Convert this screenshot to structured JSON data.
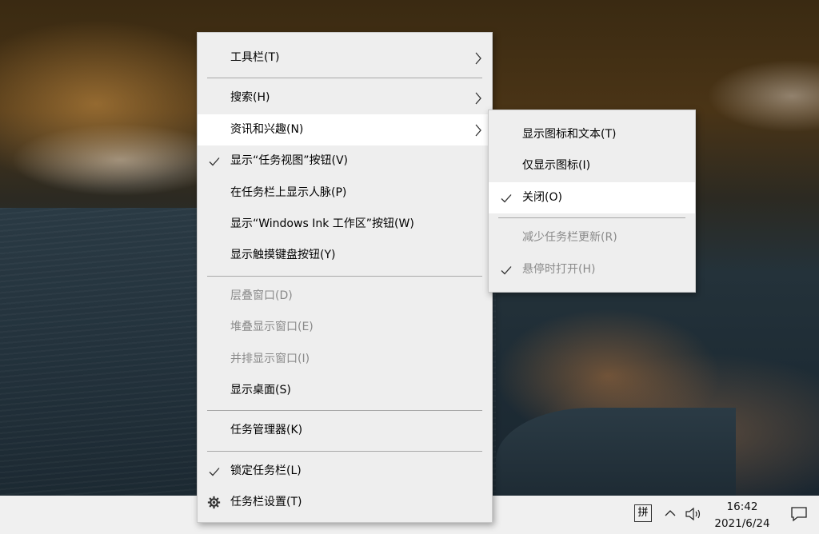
{
  "main_menu": {
    "groups": [
      [
        {
          "label": "工具栏(T)",
          "submenu": true
        }
      ],
      [
        {
          "label": "搜索(H)",
          "submenu": true
        },
        {
          "label": "资讯和兴趣(N)",
          "submenu": true,
          "highlighted": true
        },
        {
          "label": "显示“任务视图”按钮(V)",
          "checked": true
        },
        {
          "label": "在任务栏上显示人脉(P)"
        },
        {
          "label": "显示“Windows Ink 工作区”按钮(W)"
        },
        {
          "label": "显示触摸键盘按钮(Y)"
        }
      ],
      [
        {
          "label": "层叠窗口(D)",
          "disabled": true
        },
        {
          "label": "堆叠显示窗口(E)",
          "disabled": true
        },
        {
          "label": "并排显示窗口(I)",
          "disabled": true
        },
        {
          "label": "显示桌面(S)"
        }
      ],
      [
        {
          "label": "任务管理器(K)"
        }
      ],
      [
        {
          "label": "锁定任务栏(L)",
          "checked": true
        },
        {
          "label": "任务栏设置(T)",
          "icon": "gear-icon"
        }
      ]
    ]
  },
  "sub_menu": {
    "groups": [
      [
        {
          "label": "显示图标和文本(T)"
        },
        {
          "label": "仅显示图标(I)"
        },
        {
          "label": "关闭(O)",
          "checked": true,
          "highlighted": true
        }
      ],
      [
        {
          "label": "减少任务栏更新(R)",
          "disabled": true
        },
        {
          "label": "悬停时打开(H)",
          "checked": true,
          "disabled": true
        }
      ]
    ]
  },
  "taskbar": {
    "ime_label": "拼",
    "time": "16:42",
    "date": "2021/6/24",
    "icons": [
      "chevron-up-icon",
      "volume-icon",
      "notification-icon"
    ]
  },
  "colors": {
    "menu_bg": "#eeeeee",
    "menu_hover": "#ffffff",
    "disabled_text": "#8a8a8a",
    "taskbar_bg": "#f0f0f0"
  }
}
